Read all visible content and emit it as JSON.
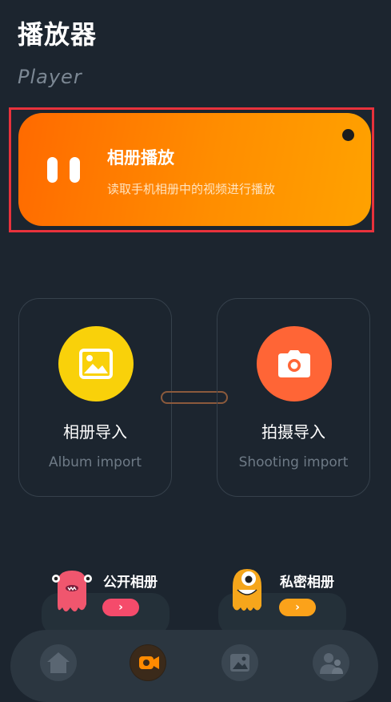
{
  "header": {
    "title": "播放器",
    "subtitle": "Player"
  },
  "play_card": {
    "title": "相册播放",
    "description": "读取手机相册中的视频进行播放",
    "icon": "pause-icon"
  },
  "actions": [
    {
      "label": "相册导入",
      "english": "Album import",
      "icon": "image-icon",
      "color": "#f9d10a"
    },
    {
      "label": "拍摄导入",
      "english": "Shooting import",
      "icon": "camera-icon",
      "color": "#ff6536"
    }
  ],
  "albums": [
    {
      "label": "公开相册",
      "button": "›",
      "color": "#f54b6b",
      "mascot": "pink-monster-icon"
    },
    {
      "label": "私密相册",
      "button": "›",
      "color": "#fba21a",
      "mascot": "orange-monster-icon"
    }
  ],
  "tabbar": {
    "items": [
      {
        "icon": "home-icon",
        "active": false
      },
      {
        "icon": "video-camera-icon",
        "active": true
      },
      {
        "icon": "gallery-icon",
        "active": false
      },
      {
        "icon": "user-icon",
        "active": false
      }
    ]
  },
  "colors": {
    "background": "#1c252f",
    "accent": "#ff8a00",
    "highlight_border": "#e8323c"
  }
}
